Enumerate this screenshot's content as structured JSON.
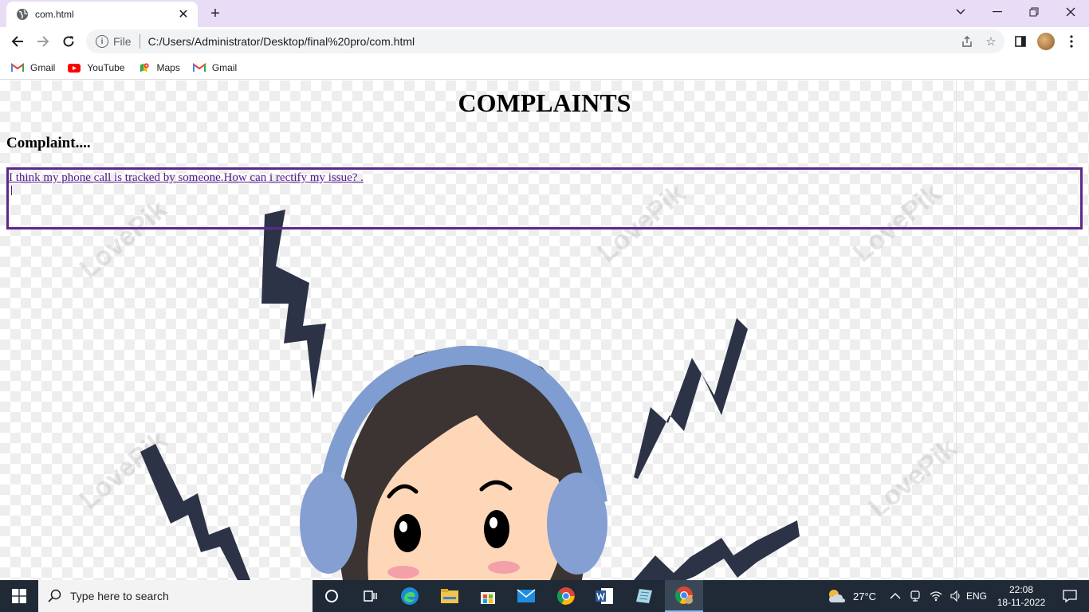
{
  "browser": {
    "tab_title": "com.html",
    "scheme_label": "File",
    "url": "C:/Users/Administrator/Desktop/final%20pro/com.html",
    "bookmarks": [
      {
        "label": "Gmail",
        "icon": "gmail-icon"
      },
      {
        "label": "YouTube",
        "icon": "youtube-icon"
      },
      {
        "label": "Maps",
        "icon": "maps-icon"
      },
      {
        "label": "Gmail",
        "icon": "gmail-icon"
      }
    ]
  },
  "page": {
    "title": "COMPLAINTS",
    "subtitle": "Complaint....",
    "complaint_text": "I think my phone call is tracked by someone.How can i rectify my issue? ."
  },
  "taskbar": {
    "search_placeholder": "Type here to search",
    "weather": "27°C",
    "language": "ENG",
    "time": "22:08",
    "date": "18-11-2022"
  },
  "colors": {
    "tab_strip": "#e8dcf7",
    "box_border": "#5a2a8a",
    "link": "#551a8b",
    "taskbar": "#1f2a36"
  }
}
